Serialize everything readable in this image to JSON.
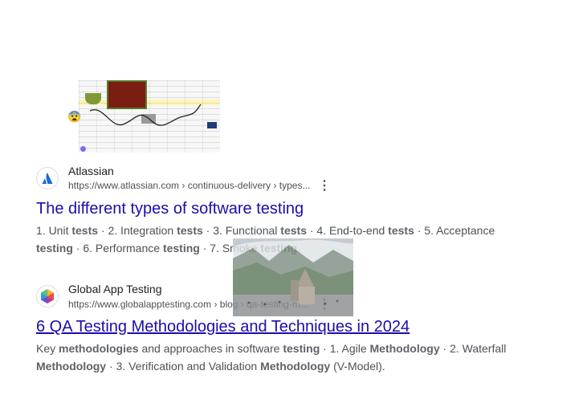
{
  "results": [
    {
      "site_name": "Atlassian",
      "url": "https://www.atlassian.com",
      "breadcrumb": " › continuous-delivery › types...",
      "title": "The different types of software testing",
      "snippet_line1": [
        {
          "t": "1. Unit ",
          "b": false
        },
        {
          "t": "tests",
          "b": true
        },
        {
          "t": " · 2. Integration ",
          "b": false
        },
        {
          "t": "tests",
          "b": true
        },
        {
          "t": " · 3. Functional ",
          "b": false
        },
        {
          "t": "tests",
          "b": true
        },
        {
          "t": " · 4. End-to-end ",
          "b": false
        },
        {
          "t": "tests",
          "b": true
        },
        {
          "t": " · 5. Acceptance",
          "b": false
        }
      ],
      "snippet_line2": [
        {
          "t": "testing",
          "b": true
        },
        {
          "t": " · 6. Performance ",
          "b": false
        },
        {
          "t": "testing",
          "b": true
        },
        {
          "t": " · 7. Smoke ",
          "b": false
        },
        {
          "t": "testing",
          "b": true
        },
        {
          "t": ".",
          "b": false
        }
      ]
    },
    {
      "site_name": "Global App Testing",
      "url": "https://www.globalapptesting.com",
      "breadcrumb": " › blog › qa-testing-m...",
      "title": "6 QA Testing Methodologies and Techniques in 2024",
      "snippet_line1": [
        {
          "t": "Key ",
          "b": false
        },
        {
          "t": "methodologies",
          "b": true
        },
        {
          "t": " and approaches in software ",
          "b": false
        },
        {
          "t": "testing",
          "b": true
        },
        {
          "t": " · 1. Agile ",
          "b": false
        },
        {
          "t": "Methodology",
          "b": true
        },
        {
          "t": " · 2. Waterfall",
          "b": false
        }
      ],
      "snippet_line2": [
        {
          "t": "Methodology",
          "b": true
        },
        {
          "t": " · 3. Verification and Validation ",
          "b": false
        },
        {
          "t": "Methodology",
          "b": true
        },
        {
          "t": " (V-Model).",
          "b": false
        }
      ]
    }
  ],
  "icons": {
    "menu": "⋮",
    "emoji": "😨",
    "atlassian_logo": "atlassian-logo-icon",
    "globalapp_logo": "global-app-testing-logo-icon"
  },
  "colors": {
    "link": "#1a0dab",
    "atlassian_blue": "#1868db",
    "snippet": "#4d5156"
  }
}
